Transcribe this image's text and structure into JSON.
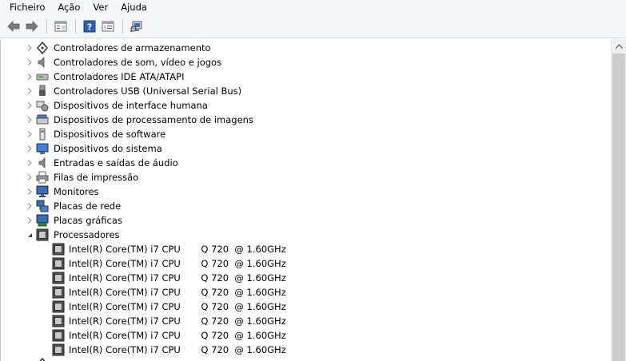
{
  "menu": {
    "file": "Ficheiro",
    "action": "Ação",
    "view": "Ver",
    "help": "Ajuda"
  },
  "toolbar": {
    "buttons": [
      "back-arrow-icon",
      "forward-arrow-icon",
      "properties-icon",
      "help-icon",
      "view-icon",
      "scan-hardware-icon"
    ]
  },
  "tree": {
    "categories": [
      {
        "label": "Controladores de armazenamento",
        "icon": "storage-controller-icon",
        "expanded": false
      },
      {
        "label": "Controladores de som, vídeo e jogos",
        "icon": "speaker-icon",
        "expanded": false
      },
      {
        "label": "Controladores IDE ATA/ATAPI",
        "icon": "ide-drive-icon",
        "expanded": false
      },
      {
        "label": "Controladores USB (Universal Serial Bus)",
        "icon": "usb-icon",
        "expanded": false
      },
      {
        "label": "Dispositivos de interface humana",
        "icon": "hid-icon",
        "expanded": false
      },
      {
        "label": "Dispositivos de processamento de imagens",
        "icon": "imaging-device-icon",
        "expanded": false
      },
      {
        "label": "Dispositivos de software",
        "icon": "software-device-icon",
        "expanded": false
      },
      {
        "label": "Dispositivos do sistema",
        "icon": "system-device-icon",
        "expanded": false
      },
      {
        "label": "Entradas e saídas de áudio",
        "icon": "audio-io-icon",
        "expanded": false
      },
      {
        "label": "Filas de impressão",
        "icon": "printer-icon",
        "expanded": false
      },
      {
        "label": "Monitores",
        "icon": "monitor-icon",
        "expanded": false
      },
      {
        "label": "Placas de rede",
        "icon": "network-adapter-icon",
        "expanded": false
      },
      {
        "label": "Placas gráficas",
        "icon": "display-adapter-icon",
        "expanded": false
      },
      {
        "label": "Processadores",
        "icon": "processor-icon",
        "expanded": true
      }
    ],
    "processors": [
      "Intel(R) Core(TM) i7 CPU       Q 720  @ 1.60GHz",
      "Intel(R) Core(TM) i7 CPU       Q 720  @ 1.60GHz",
      "Intel(R) Core(TM) i7 CPU       Q 720  @ 1.60GHz",
      "Intel(R) Core(TM) i7 CPU       Q 720  @ 1.60GHz",
      "Intel(R) Core(TM) i7 CPU       Q 720  @ 1.60GHz",
      "Intel(R) Core(TM) i7 CPU       Q 720  @ 1.60GHz",
      "Intel(R) Core(TM) i7 CPU       Q 720  @ 1.60GHz",
      "Intel(R) Core(TM) i7 CPU       Q 720  @ 1.60GHz"
    ]
  },
  "colors": {
    "toolbar_bg": "#f5f6f7",
    "scroll_thumb": "#cdcdcd",
    "icon_blue": "#1f5fb3"
  }
}
